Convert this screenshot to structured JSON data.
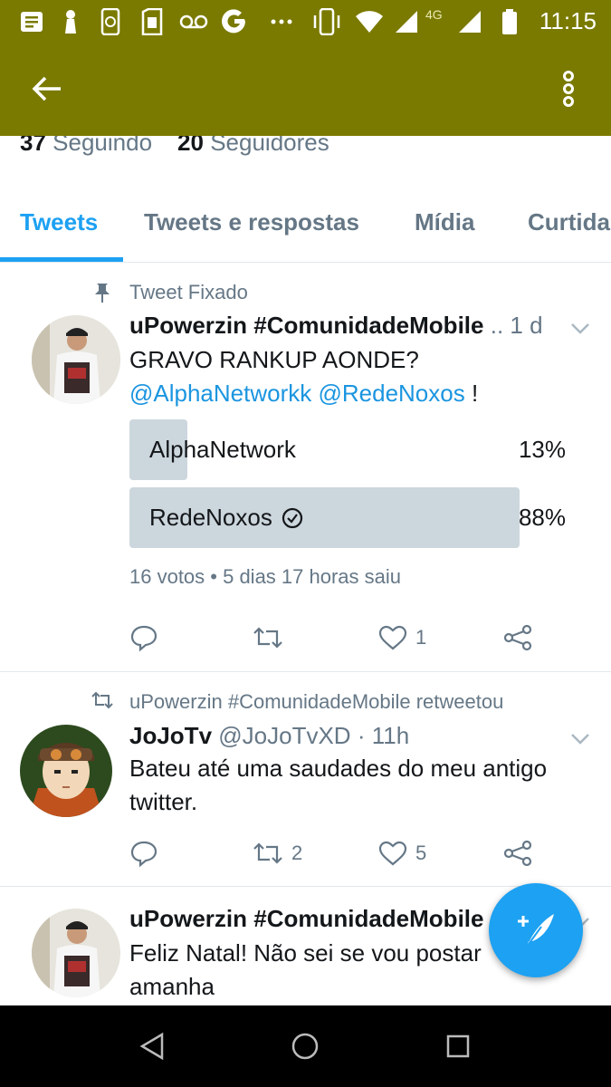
{
  "status_bar": {
    "time": "11:15",
    "network_label": "4G",
    "icons": [
      "notification-icon",
      "tie-icon",
      "phone-update-icon",
      "sim-icon",
      "voicemail-icon",
      "google-icon",
      "more-dots-icon",
      "vibrate-icon",
      "wifi-icon",
      "signal-icon",
      "signal-icon",
      "battery-icon"
    ]
  },
  "app_bar": {
    "back_icon": "arrow-left-icon",
    "menu_icon": "more-vertical-icon"
  },
  "profile": {
    "following_count": "37",
    "following_label": "Seguindo",
    "followers_count": "20",
    "followers_label": "Seguidores"
  },
  "tabs": [
    {
      "label": "Tweets",
      "active": true
    },
    {
      "label": "Tweets e respostas",
      "active": false
    },
    {
      "label": "Mídia",
      "active": false
    },
    {
      "label": "Curtida",
      "active": false
    }
  ],
  "tweets": [
    {
      "context": "Tweet Fixado",
      "name": "uPowerzin #ComunidadeMobile",
      "handle_truncated": "..",
      "time": "1 d",
      "text_plain": "GRAVO RANKUP AONDE?",
      "mention1": "@AlphaNetworkk",
      "mention2": "@RedeNoxos",
      "text_tail": " !",
      "poll": {
        "options": [
          {
            "label": "AlphaNetwork",
            "percent_text": "13%",
            "percent": 13,
            "selected": false
          },
          {
            "label": "RedeNoxos",
            "percent_text": "88%",
            "percent": 88,
            "selected": true
          }
        ],
        "meta": "16 votos • 5 dias 17 horas saiu"
      },
      "actions": {
        "reply": "",
        "retweet": "",
        "like": "1"
      }
    },
    {
      "context": "uPowerzin #ComunidadeMobile retweetou",
      "name": "JoJoTv",
      "handle": "@JoJoTvXD",
      "time": "· 11h",
      "text": "Bateu até uma saudades do meu antigo twitter.",
      "actions": {
        "reply": "",
        "retweet": "2",
        "like": "5"
      }
    },
    {
      "name": "uPowerzin #ComunidadeMobile",
      "text": "Feliz Natal! Não sei se vou postar amanha"
    }
  ],
  "colors": {
    "app_bar": "#7a7a00",
    "accent": "#1da1f2",
    "mention": "#1b95e0",
    "secondary_text": "#657786"
  }
}
